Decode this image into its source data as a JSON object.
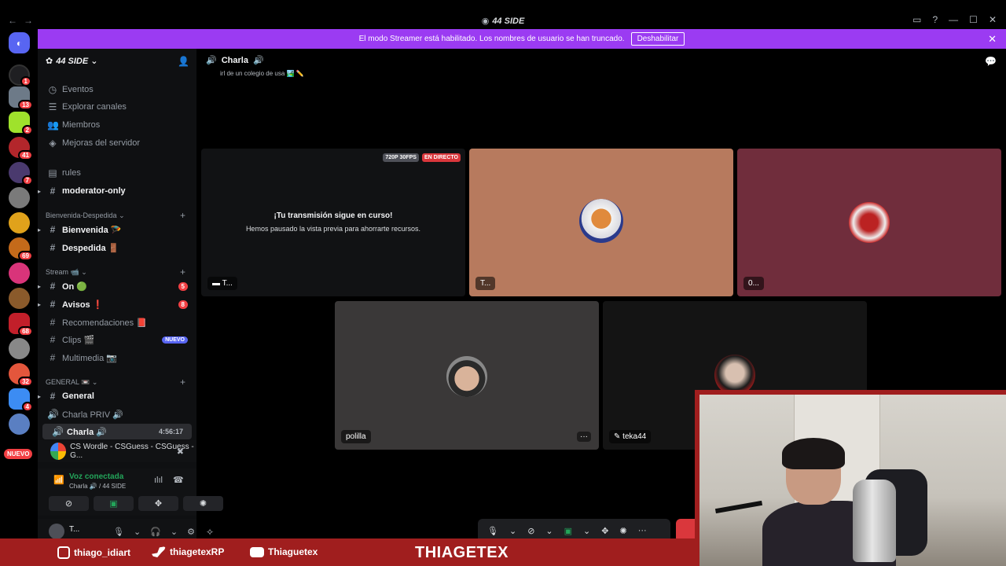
{
  "window": {
    "title": "44 SIDE",
    "nav_back": "←",
    "nav_fwd": "→",
    "controls": [
      "▭",
      "?",
      "—",
      "☐",
      "✕"
    ]
  },
  "banner": {
    "text": "El modo Streamer está habilitado. Los nombres de usuario se han truncado.",
    "button": "Deshabilitar",
    "close": "✕"
  },
  "rail": {
    "home_icon": "discord-logo",
    "badges": [
      "1",
      "13",
      "2",
      "41",
      "7",
      "69",
      "68",
      "32",
      "4"
    ],
    "nuevo": "NUEVO"
  },
  "sidebar": {
    "guild_name": "44 SIDE",
    "caret": "⌄",
    "items": [
      {
        "label": "Eventos",
        "icon": "◷"
      },
      {
        "label": "Explorar canales",
        "icon": "☰"
      },
      {
        "label": "Miembros",
        "icon": "👥"
      },
      {
        "label": "Mejoras del servidor",
        "icon": "◈"
      }
    ],
    "channels_top": [
      {
        "label": "rules",
        "icon": "▤"
      },
      {
        "label": "moderator-only",
        "icon": "#"
      }
    ],
    "cat1": "Bienvenida-Despedida ⌄",
    "cat1_channels": [
      {
        "label": "Bienvenida 🪂",
        "icon": "#"
      },
      {
        "label": "Despedida 🚪",
        "icon": "#"
      }
    ],
    "cat2": "Stream 📹 ⌄",
    "cat2_channels": [
      {
        "label": "On 🟢",
        "icon": "#",
        "count": "5"
      },
      {
        "label": "Avisos ❗",
        "icon": "#",
        "count": "8"
      },
      {
        "label": "Recomendaciones 📕",
        "icon": "#"
      },
      {
        "label": "Clips 🎬",
        "icon": "#",
        "new": "NUEVO"
      },
      {
        "label": "Multimedia 📷",
        "icon": "#"
      }
    ],
    "cat3": "GENERAL 📼 ⌄",
    "cat3_channels": [
      {
        "label": "General",
        "icon": "#"
      },
      {
        "label": "Charla PRIV 🔊",
        "icon": "🔊"
      },
      {
        "label": "Charla 🔊",
        "icon": "🔊",
        "time": "4:56:17"
      }
    ],
    "activity": "CS Wordle - CSGuess - CSGuess - G...",
    "voice_status": "Voz conectada",
    "voice_sub": "Charla 🔊 / 44 SIDE",
    "voice_buttons": [
      "⊘",
      "▣",
      "✥",
      "✺"
    ],
    "user_name": "T...",
    "user_controls": [
      "🎙",
      "⌄",
      "🎧",
      "⌄",
      "⚙"
    ]
  },
  "main": {
    "channel_name": "Charla",
    "topic": "irl de un colegio de usa 🏞️ ✏️",
    "tiles": [
      {
        "label": "T...",
        "tag_quality": "720P 30FPS",
        "tag_live": "EN DIRECTO",
        "msg_title": "¡Tu transmisión sigue en curso!",
        "msg_body": "Hemos pausado la vista previa para ahorrarte recursos."
      },
      {
        "label": "T..."
      },
      {
        "label": "0..."
      },
      {
        "label": "polilla",
        "more": "···"
      },
      {
        "label": "teka44"
      }
    ],
    "controls": [
      "🎙",
      "⌄",
      "⊘",
      "⌄",
      "▣",
      "⌄",
      "✥",
      "✺",
      "···"
    ]
  },
  "overlay": {
    "instagram": "thiago_idiart",
    "twitter": "thiagetexRP",
    "youtube": "Thiaguetex",
    "brand": "THIAGETEX"
  }
}
